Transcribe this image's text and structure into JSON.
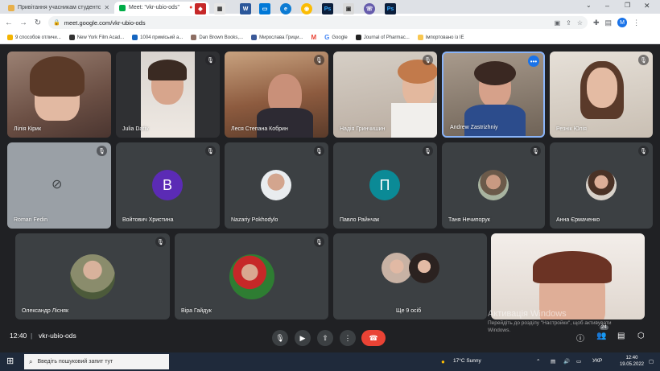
{
  "browser": {
    "tabs": [
      {
        "title": "Привітання учасникам студентс",
        "active": false
      },
      {
        "title": "Meet: \"vkr-ubio-ods\"",
        "active": true
      }
    ],
    "new_tab": "+",
    "url": "meet.google.com/vkr-ubio-ods",
    "profile_initial": "M",
    "bookmarks": [
      "9 способов отличи...",
      "New York Film Acad...",
      "1004 примісьий а...",
      "Dan Brown Books,...",
      "Мирослава Грици...",
      "",
      "Google",
      "Journal of Pharmac...",
      "Імпортовано із IE"
    ]
  },
  "participants": [
    {
      "name": "Лілія Кірик"
    },
    {
      "name": "Julia Dariv"
    },
    {
      "name": "Леся Степана Кобрин"
    },
    {
      "name": "Надія Гринчишин"
    },
    {
      "name": "Andrew Zastrizhniy"
    },
    {
      "name": "Резнік Юлія"
    },
    {
      "name": "Roman Fedin"
    },
    {
      "name": "Войтович Христина",
      "initial": "В"
    },
    {
      "name": "Nazariy Pokhodylo"
    },
    {
      "name": "Павло Райнчак",
      "initial": "П"
    },
    {
      "name": "Таня Нечипорук"
    },
    {
      "name": "Анна Єрмаченко"
    },
    {
      "name": "Олександр Лісняк"
    },
    {
      "name": "Віра Гайдук"
    },
    {
      "name": "Ще 9 осіб"
    }
  ],
  "colors": {
    "avatar_purple": "#5b2bb5",
    "avatar_teal": "#0b8a96",
    "end_call": "#ea4335",
    "active_border": "#8ab4f8",
    "meet_bg": "#202124"
  },
  "controls": {
    "time": "12:40",
    "separator": "|",
    "meeting_code": "vkr-ubio-ods",
    "participants_badge": "24"
  },
  "windows_activation": {
    "title": "Активація Windows",
    "line1": "Перейдіть до розділу \"Настройки\", щоб активувати",
    "line2": "Windows."
  },
  "taskbar": {
    "search_placeholder": "Введіть пошуковий запит тут",
    "weather": "17°C  Sunny",
    "lang": "УКР",
    "time": "12:40",
    "date": "19.05.2022"
  }
}
